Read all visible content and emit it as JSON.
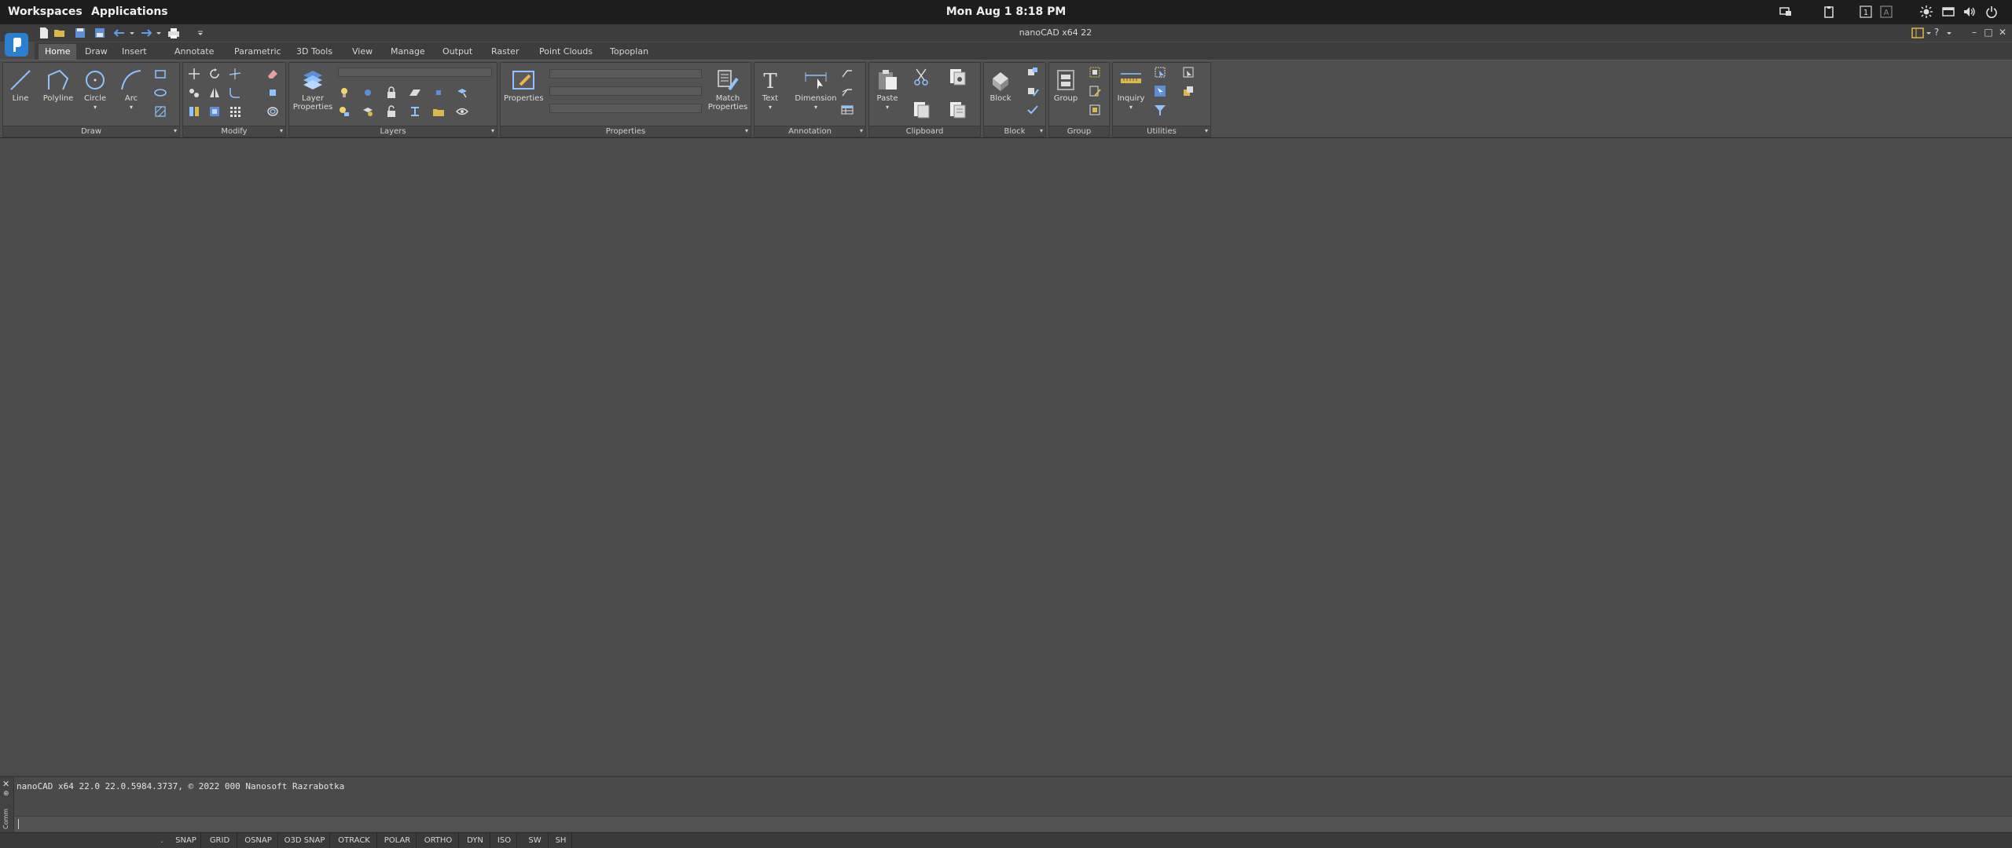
{
  "topbar": {
    "workspaces": "Workspaces",
    "applications": "Applications",
    "clock": "Mon Aug 1   8:18 PM",
    "tray_icons": [
      "display-icon",
      "clipboard-icon",
      "keyboard-layout-1-icon",
      "keyboard-layout-a-icon",
      "brightness-icon",
      "window-icon",
      "volume-icon",
      "power-icon"
    ]
  },
  "titlebar": {
    "app_title": "nanoCAD x64 22",
    "quick_access": [
      "new-icon",
      "open-icon",
      "save-icon",
      "save-as-icon",
      "undo-icon",
      "redo-icon",
      "print-icon",
      "customize-icon"
    ],
    "help": "?",
    "window_controls": [
      "–",
      "□",
      "✕"
    ]
  },
  "tabs": [
    {
      "label": "Home",
      "active": true
    },
    {
      "label": "Draw"
    },
    {
      "label": "Insert"
    },
    {
      "label": "Annotate"
    },
    {
      "label": "Parametric"
    },
    {
      "label": "3D Tools"
    },
    {
      "label": "View"
    },
    {
      "label": "Manage"
    },
    {
      "label": "Output"
    },
    {
      "label": "Raster"
    },
    {
      "label": "Point Clouds"
    },
    {
      "label": "Topoplan"
    }
  ],
  "ribbon": {
    "draw": {
      "label": "Draw",
      "line": "Line",
      "polyline": "Polyline",
      "circle": "Circle",
      "arc": "Arc"
    },
    "modify": {
      "label": "Modify"
    },
    "layers": {
      "label": "Layers",
      "layer_properties_1": "Layer",
      "layer_properties_2": "Properties"
    },
    "properties": {
      "label": "Properties",
      "properties": "Properties",
      "match_1": "Match",
      "match_2": "Properties"
    },
    "annotation": {
      "label": "Annotation",
      "text": "Text",
      "dimension": "Dimension"
    },
    "clipboard": {
      "label": "Clipboard",
      "paste": "Paste"
    },
    "block": {
      "label": "Block",
      "block": "Block"
    },
    "group": {
      "label": "Group",
      "group": "Group"
    },
    "utilities": {
      "label": "Utilities",
      "inquiry": "Inquiry"
    }
  },
  "command": {
    "history": "nanoCAD x64 22.0 22.0.5984.3737, © 2022 000 Nanosoft Razrabotka",
    "side_label": "Comm"
  },
  "statusbar": {
    "items": [
      ".",
      "SNAP",
      "GRID",
      "OSNAP",
      "O3D SNAP",
      "OTRACK",
      "POLAR",
      "ORTHO",
      "DYN",
      "ISO",
      "SW",
      "SH"
    ]
  },
  "colors": {
    "accent": "#2a7fd1",
    "background": "#4b4b4b",
    "topbar": "#1d1d1d"
  }
}
